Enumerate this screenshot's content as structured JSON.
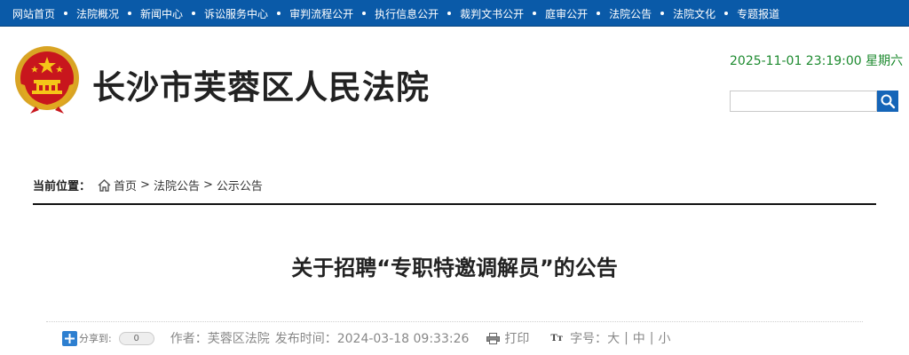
{
  "nav": {
    "items": [
      {
        "label": "网站首页"
      },
      {
        "label": "法院概况"
      },
      {
        "label": "新闻中心"
      },
      {
        "label": "诉讼服务中心"
      },
      {
        "label": "审判流程公开"
      },
      {
        "label": "执行信息公开"
      },
      {
        "label": "裁判文书公开"
      },
      {
        "label": "庭审公开"
      },
      {
        "label": "法院公告"
      },
      {
        "label": "法院文化"
      },
      {
        "label": "专题报道"
      }
    ]
  },
  "header": {
    "title": "长沙市芙蓉区人民法院",
    "datetime": "2025-11-01 23:19:00 星期六",
    "search_value": ""
  },
  "breadcrumb": {
    "label": "当前位置：",
    "items": [
      "首页",
      "法院公告",
      "公示公告"
    ],
    "separator": ">"
  },
  "article": {
    "title": "关于招聘“专职特邀调解员”的公告",
    "share_label": "分享到:",
    "share_count": "0",
    "author_label": "作者：芙蓉区法院",
    "publish_label": "发布时间：2024-03-18 09:33:26",
    "print_label": "打印",
    "fontsize_label": "字号：",
    "fontsize_options": [
      "大",
      "中",
      "小"
    ]
  },
  "colors": {
    "nav_bg": "#0a5aa8",
    "datetime": "#1d8a2f",
    "search_button": "#1565b8"
  },
  "icons": {
    "emblem": "national-emblem-icon",
    "search": "search-icon",
    "home": "home-icon",
    "share": "share-icon",
    "print": "printer-icon",
    "fontsize": "font-size-icon"
  }
}
